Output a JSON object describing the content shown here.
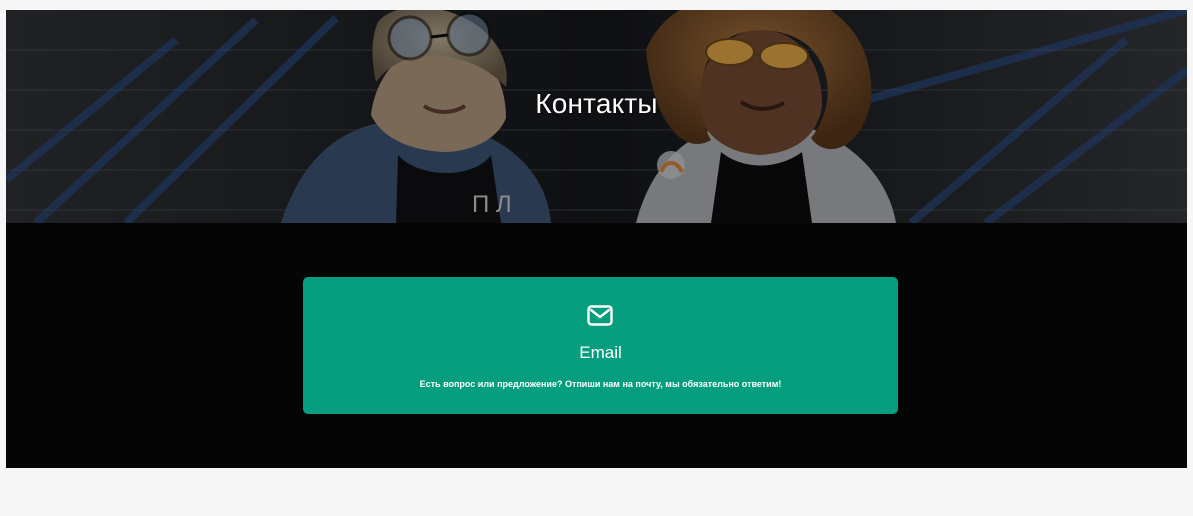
{
  "hero": {
    "title": "Контакты",
    "image": "two-people-in-sunglasses-photo"
  },
  "contact_card": {
    "icon": "mail-icon",
    "title": "Email",
    "text": "Есть вопрос или предложение? Отпиши нам на почту, мы обязательно ответим!",
    "color": "#079e7f"
  },
  "colors": {
    "hero_bg": "#1c1c1f",
    "section_bg": "#050505",
    "page_bg": "#f6f6f6",
    "text": "#ffffff"
  }
}
